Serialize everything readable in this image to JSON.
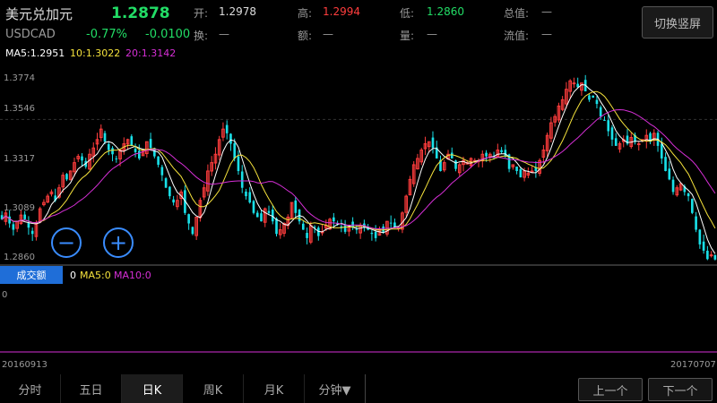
{
  "header": {
    "name": "美元兑加元",
    "symbol": "USDCAD",
    "price": "1.2878",
    "change_pct": "-0.77%",
    "change": "-0.0100",
    "open_label": "开:",
    "open_value": "1.2978",
    "high_label": "高:",
    "high_value": "1.2994",
    "low_label": "低:",
    "low_value": "1.2860",
    "total_label": "总值:",
    "total_value": "—",
    "turnover_label": "换:",
    "turnover_value": "—",
    "amount_label": "额:",
    "amount_value": "—",
    "volume_label": "量:",
    "volume_value": "—",
    "float_label": "流值:",
    "float_value": "—",
    "switch_label": "切换竖屏"
  },
  "ma_legend": {
    "ma5": "MA5:1.2951",
    "ma10": "10:1.3022",
    "ma20": "20:1.3142"
  },
  "y_axis": {
    "labels": [
      "1.3774",
      "1.3546",
      "1.3317",
      "1.3089",
      "1.2860"
    ]
  },
  "zoom": {
    "minus": "−",
    "plus": "+"
  },
  "volume_panel": {
    "button": "成交额",
    "value": "0",
    "ma5": "MA5:0",
    "ma10": "MA10:0",
    "zero": "0"
  },
  "dates": {
    "start": "20160913",
    "end": "20170707"
  },
  "tabs": [
    "分时",
    "五日",
    "日K",
    "周K",
    "月K",
    "分钟▼"
  ],
  "active_tab": "日K",
  "nav": {
    "prev": "上一个",
    "next": "下一个"
  },
  "colors": {
    "up": "#ff3d3d",
    "down": "#19e0e8",
    "ma5": "#ffffff",
    "ma10": "#f5e23c",
    "ma20": "#d62fd6",
    "accent": "#3a8cff"
  },
  "chart_data": {
    "type": "candlestick",
    "ylim": [
      1.286,
      1.3774
    ],
    "closes": [
      1.307,
      1.31,
      1.305,
      1.302,
      1.306,
      1.309,
      1.307,
      1.303,
      1.3,
      1.305,
      1.312,
      1.315,
      1.318,
      1.32,
      1.316,
      1.322,
      1.328,
      1.326,
      1.33,
      1.334,
      1.337,
      1.335,
      1.332,
      1.338,
      1.341,
      1.345,
      1.35,
      1.344,
      1.34,
      1.338,
      1.336,
      1.34,
      1.343,
      1.345,
      1.342,
      1.339,
      1.336,
      1.34,
      1.344,
      1.341,
      1.337,
      1.333,
      1.328,
      1.322,
      1.318,
      1.315,
      1.316,
      1.32,
      1.31,
      1.305,
      1.3,
      1.308,
      1.316,
      1.322,
      1.33,
      1.334,
      1.338,
      1.345,
      1.35,
      1.348,
      1.343,
      1.336,
      1.33,
      1.322,
      1.318,
      1.315,
      1.31,
      1.308,
      1.306,
      1.312,
      1.31,
      1.306,
      1.3,
      1.302,
      1.305,
      1.308,
      1.315,
      1.31,
      1.306,
      1.302,
      1.298,
      1.304,
      1.303,
      1.299,
      1.301,
      1.304,
      1.307,
      1.306,
      1.305,
      1.303,
      1.301,
      1.304,
      1.303,
      1.302,
      1.304,
      1.303,
      1.302,
      1.3,
      1.298,
      1.302,
      1.301,
      1.306,
      1.305,
      1.303,
      1.303,
      1.31,
      1.318,
      1.326,
      1.333,
      1.336,
      1.34,
      1.343,
      1.344,
      1.341,
      1.336,
      1.33,
      1.334,
      1.338,
      1.336,
      1.331,
      1.333,
      1.335,
      1.334,
      1.336,
      1.335,
      1.335,
      1.338,
      1.337,
      1.338,
      1.337,
      1.34,
      1.339,
      1.337,
      1.331,
      1.333,
      1.33,
      1.327,
      1.33,
      1.329,
      1.33,
      1.33,
      1.335,
      1.34,
      1.347,
      1.353,
      1.356,
      1.361,
      1.364,
      1.369,
      1.373,
      1.372,
      1.37,
      1.372,
      1.368,
      1.364,
      1.365,
      1.362,
      1.356,
      1.354,
      1.349,
      1.345,
      1.342,
      1.343,
      1.345,
      1.343,
      1.346,
      1.344,
      1.343,
      1.345,
      1.347,
      1.344,
      1.348,
      1.342,
      1.336,
      1.33,
      1.326,
      1.32,
      1.322,
      1.324,
      1.32,
      1.318,
      1.31,
      1.302,
      1.295,
      1.292,
      1.288,
      1.29,
      1.2878
    ]
  }
}
